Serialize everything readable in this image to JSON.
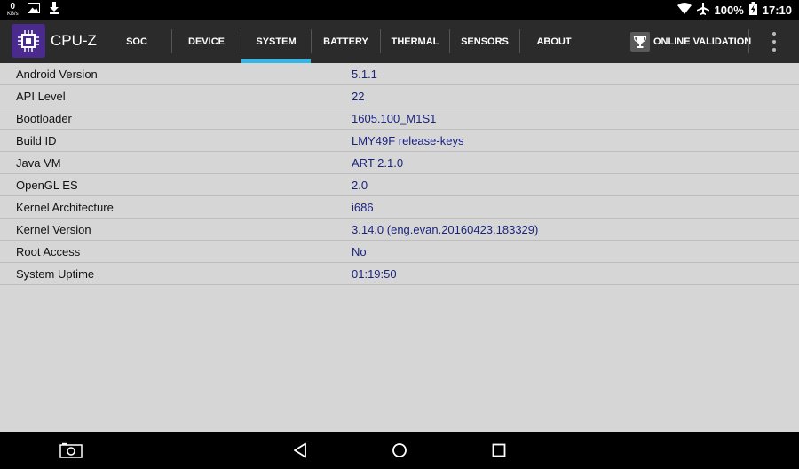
{
  "status_bar": {
    "net_speed_value": "0",
    "net_speed_unit": "KB/s",
    "battery_percent": "100%",
    "time": "17:10",
    "icons": [
      "image-icon",
      "download-icon",
      "wifi-icon",
      "airplane-icon",
      "battery-charging-icon"
    ]
  },
  "app": {
    "title": "CPU-Z",
    "tabs": [
      "SOC",
      "DEVICE",
      "SYSTEM",
      "BATTERY",
      "THERMAL",
      "SENSORS",
      "ABOUT"
    ],
    "active_tab": "SYSTEM",
    "online_validation_label": "ONLINE VALIDATION"
  },
  "system_info": [
    {
      "label": "Android Version",
      "value": "5.1.1"
    },
    {
      "label": "API Level",
      "value": "22"
    },
    {
      "label": "Bootloader",
      "value": "1605.100_M1S1"
    },
    {
      "label": "Build ID",
      "value": "LMY49F release-keys"
    },
    {
      "label": "Java VM",
      "value": "ART 2.1.0"
    },
    {
      "label": "OpenGL ES",
      "value": "2.0"
    },
    {
      "label": "Kernel Architecture",
      "value": "i686"
    },
    {
      "label": "Kernel Version",
      "value": "3.14.0 (eng.evan.20160423.183329)"
    },
    {
      "label": "Root Access",
      "value": "No"
    },
    {
      "label": "System Uptime",
      "value": "01:19:50"
    }
  ],
  "colors": {
    "accent": "#33b5e5",
    "value_text": "#1a237e",
    "app_bar": "#2b2b2b",
    "background": "#d6d6d6"
  }
}
